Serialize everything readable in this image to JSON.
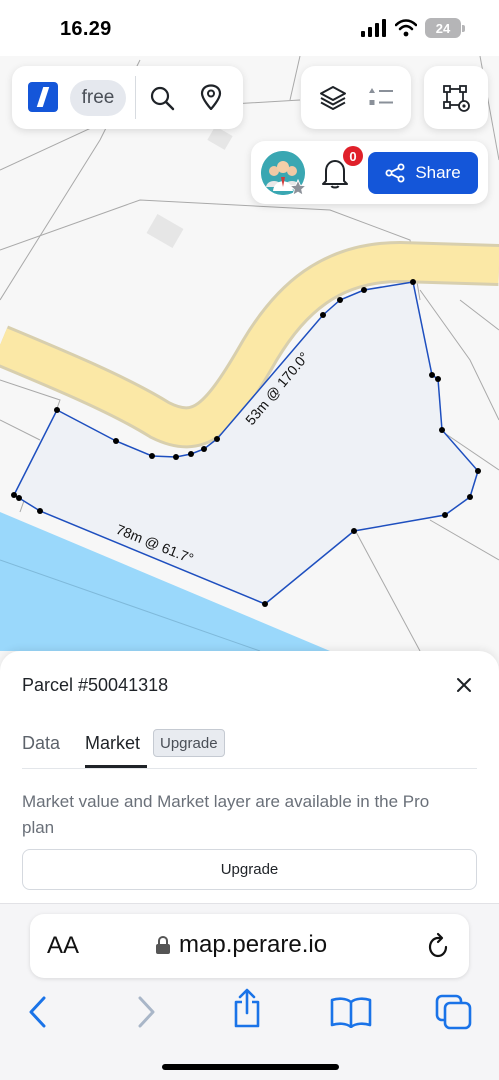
{
  "status": {
    "time": "16.29",
    "battery": "24"
  },
  "toolbar": {
    "plan_badge": "free"
  },
  "notifications": {
    "count": "0"
  },
  "share": {
    "label": "Share"
  },
  "map": {
    "measurements": [
      {
        "label": "53m @ 170.0°"
      },
      {
        "label": "78m @ 61.7°"
      }
    ],
    "colors": {
      "parcel_fill": "#eef1f6",
      "parcel_stroke": "#1e4fbf",
      "road": "#fbe8a6",
      "water": "#9ad8fb"
    }
  },
  "sheet": {
    "title": "Parcel #50041318",
    "tabs": [
      {
        "label": "Data"
      },
      {
        "label": "Market",
        "badge": "Upgrade"
      }
    ],
    "description": "Market value and Market layer are available in the Pro plan",
    "upgrade_button": "Upgrade"
  },
  "browser": {
    "aa_label": "AA",
    "url": "map.perare.io"
  },
  "accent_color": "#1456d9"
}
